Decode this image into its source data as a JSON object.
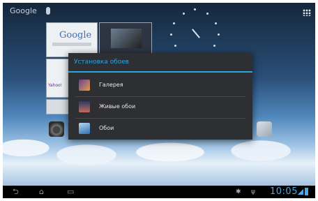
{
  "search": {
    "label": "Google"
  },
  "dialog": {
    "title": "Установка обоев",
    "items": [
      {
        "label": "Галерея",
        "icon": "gallery-icon"
      },
      {
        "label": "Живые обои",
        "icon": "live-wallpaper-icon"
      },
      {
        "label": "Обои",
        "icon": "wallpaper-icon"
      }
    ]
  },
  "thumbs": {
    "google_logo": "Google",
    "yahoo": "Yahoo!"
  },
  "status": {
    "time": "10:05"
  },
  "colors": {
    "accent": "#2aa7e0",
    "dialog_bg": "#2e2f33",
    "navbar": "#000000"
  }
}
